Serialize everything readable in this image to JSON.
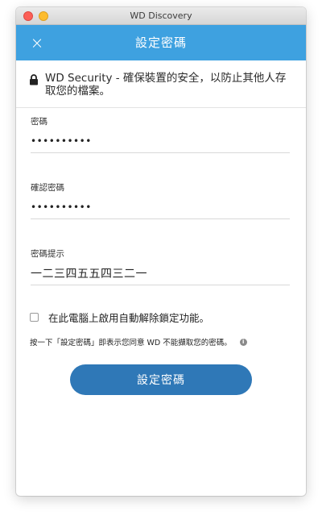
{
  "window": {
    "title": "WD Discovery"
  },
  "header": {
    "close_label": "×",
    "title": "設定密碼"
  },
  "security_note": {
    "text": "WD Security - 確保裝置的安全，以防止其他人存取您的檔案。"
  },
  "form": {
    "password": {
      "label": "密碼",
      "value": "••••••••••"
    },
    "confirm": {
      "label": "確認密碼",
      "value": "••••••••••"
    },
    "hint": {
      "label": "密碼提示",
      "value": "一二三四五五四三二一"
    }
  },
  "auto_unlock": {
    "label": "在此電腦上啟用自動解除鎖定功能。"
  },
  "consent": {
    "text": "按一下「設定密碼」即表示您同意 WD 不能擷取您的密碼。",
    "info_icon": "i"
  },
  "submit": {
    "label": "設定密碼"
  },
  "colors": {
    "header_bg": "#3ea1e0",
    "button_bg": "#2f78b7"
  }
}
